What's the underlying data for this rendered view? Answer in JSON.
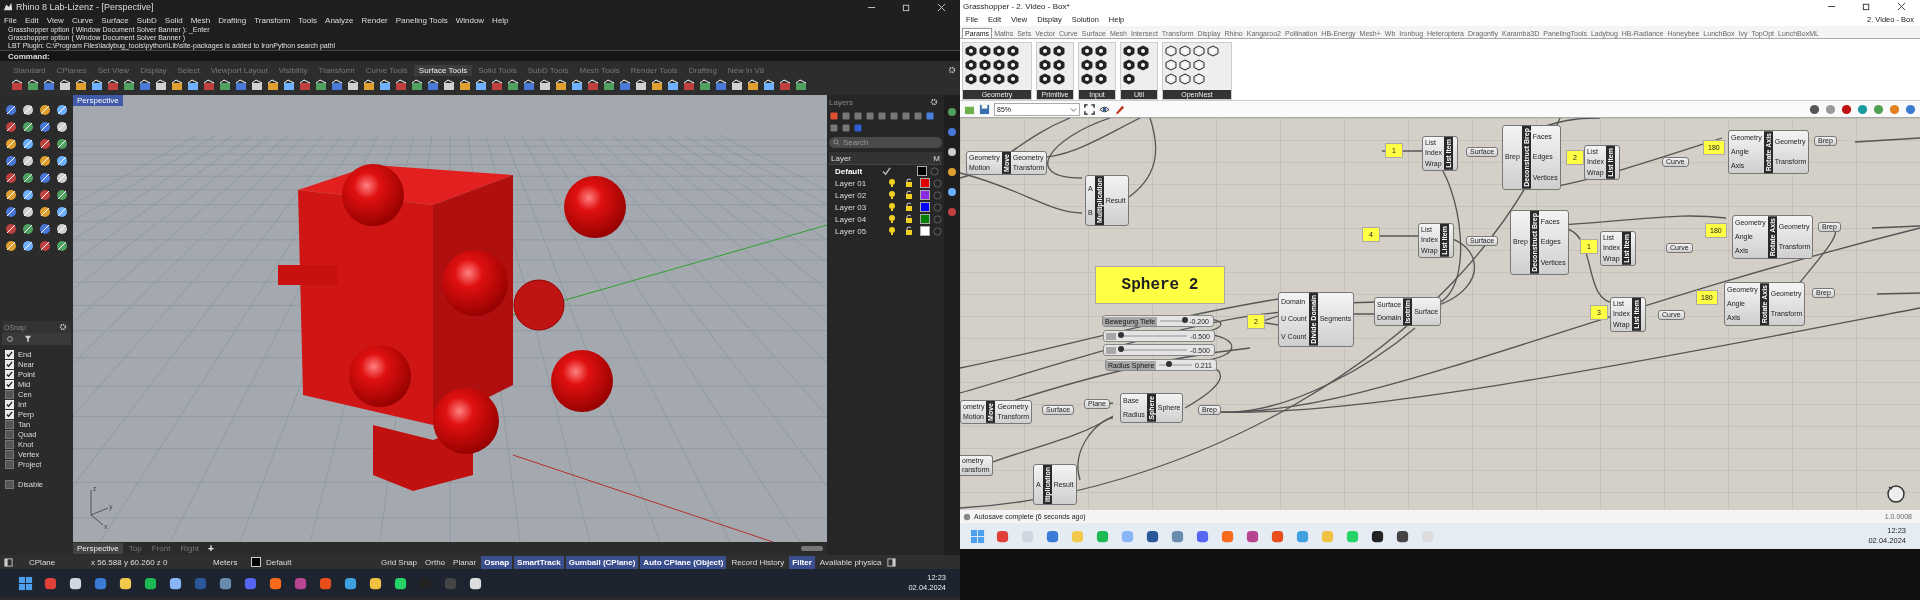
{
  "rhino": {
    "title": "Rhino 8 Lab-Lizenz - [Perspective]",
    "menu": [
      "File",
      "Edit",
      "View",
      "Curve",
      "Surface",
      "SubD",
      "Solid",
      "Mesh",
      "Drafting",
      "Transform",
      "Tools",
      "Analyze",
      "Render",
      "Paneling Tools",
      "Window",
      "Help"
    ],
    "command_history": [
      "Grasshopper option ( Window  Document  Solver  Banner ): _Enter",
      "Grasshopper option ( Window  Document  Solver  Banner )",
      "LBT Plugin: C:\\Program Files\\ladybug_tools\\python\\Lib\\site-packages is added to IronPython search path!"
    ],
    "command_label": "Command:",
    "toolbar_tabs": [
      {
        "label": "Standard",
        "selected": false
      },
      {
        "label": "CPlanes",
        "selected": false
      },
      {
        "label": "Set View",
        "selected": false
      },
      {
        "label": "Display",
        "selected": false
      },
      {
        "label": "Select",
        "selected": false
      },
      {
        "label": "Viewport Layout",
        "selected": false
      },
      {
        "label": "Visibility",
        "selected": false
      },
      {
        "label": "Transform",
        "selected": false
      },
      {
        "label": "Curve Tools",
        "selected": false
      },
      {
        "label": "Surface Tools",
        "selected": true
      },
      {
        "label": "Solid Tools",
        "selected": false
      },
      {
        "label": "SubD Tools",
        "selected": false
      },
      {
        "label": "Mesh Tools",
        "selected": false
      },
      {
        "label": "Render Tools",
        "selected": false
      },
      {
        "label": "Drafting",
        "selected": false
      },
      {
        "label": "New in V8",
        "selected": false
      }
    ],
    "viewport": {
      "label": "Perspective",
      "axis_labels": [
        "z",
        "y",
        "x"
      ]
    },
    "viewport_tabs": [
      {
        "label": "Perspective",
        "selected": true
      },
      {
        "label": "Top",
        "selected": false
      },
      {
        "label": "Front",
        "selected": false
      },
      {
        "label": "Right",
        "selected": false
      }
    ],
    "add_tab": "+",
    "osnap": {
      "title": "OSnap",
      "items": [
        {
          "label": "End",
          "checked": true
        },
        {
          "label": "Near",
          "checked": true
        },
        {
          "label": "Point",
          "checked": true
        },
        {
          "label": "Mid",
          "checked": true
        },
        {
          "label": "Cen",
          "checked": false
        },
        {
          "label": "Int",
          "checked": true
        },
        {
          "label": "Perp",
          "checked": true
        },
        {
          "label": "Tan",
          "checked": false
        },
        {
          "label": "Quad",
          "checked": false
        },
        {
          "label": "Knot",
          "checked": false
        },
        {
          "label": "Vertex",
          "checked": false
        },
        {
          "label": "Project",
          "checked": false
        }
      ],
      "disable": {
        "label": "Disable",
        "checked": false
      }
    },
    "layers": {
      "title": "Layers",
      "search_placeholder": "Search",
      "columns": [
        "Layer",
        "M"
      ],
      "rows": [
        {
          "name": "Default",
          "current": true,
          "color": "#000000"
        },
        {
          "name": "Layer 01",
          "current": false,
          "color": "#e00000"
        },
        {
          "name": "Layer 02",
          "current": false,
          "color": "#8a2be2"
        },
        {
          "name": "Layer 03",
          "current": false,
          "color": "#0000ff"
        },
        {
          "name": "Layer 04",
          "current": false,
          "color": "#008000"
        },
        {
          "name": "Layer 05",
          "current": false,
          "color": "#ffffff"
        }
      ]
    },
    "status": {
      "cplane": "CPlane",
      "coordinates": "x 56.588   y 60.260   z 0",
      "units": "Meters",
      "layer": "Default",
      "toggles": [
        {
          "label": "Grid Snap",
          "on": false
        },
        {
          "label": "Ortho",
          "on": false
        },
        {
          "label": "Planar",
          "on": false
        },
        {
          "label": "Osnap",
          "on": true
        },
        {
          "label": "SmartTrack",
          "on": true
        },
        {
          "label": "Gumball (CPlane)",
          "on": true
        },
        {
          "label": "Auto CPlane (Object)",
          "on": true
        },
        {
          "label": "Record History",
          "on": false
        },
        {
          "label": "Filter",
          "on": true
        },
        {
          "label": "Available physica",
          "on": false
        }
      ]
    }
  },
  "taskbar_left": {
    "time": "12:23",
    "date": "02.04.2024"
  },
  "grasshopper": {
    "title": "Grasshopper - 2. Video - Box*",
    "document": "2. Video - Box",
    "menu": [
      "File",
      "Edit",
      "View",
      "Display",
      "Solution",
      "Help"
    ],
    "tabs": [
      {
        "label": "Params",
        "selected": true
      },
      {
        "label": "Maths",
        "selected": false
      },
      {
        "label": "Sets",
        "selected": false
      },
      {
        "label": "Vector",
        "selected": false
      },
      {
        "label": "Curve",
        "selected": false
      },
      {
        "label": "Surface",
        "selected": false
      },
      {
        "label": "Mesh",
        "selected": false
      },
      {
        "label": "Intersect",
        "selected": false
      },
      {
        "label": "Transform",
        "selected": false
      },
      {
        "label": "Display",
        "selected": false
      },
      {
        "label": "Rhino",
        "selected": false
      },
      {
        "label": "Kangaroo2",
        "selected": false
      },
      {
        "label": "Pollination",
        "selected": false
      },
      {
        "label": "HB-Energy",
        "selected": false
      },
      {
        "label": "Mesh+",
        "selected": false
      },
      {
        "label": "Wb",
        "selected": false
      },
      {
        "label": "Ironbug",
        "selected": false
      },
      {
        "label": "Heteroptera",
        "selected": false
      },
      {
        "label": "Dragonfly",
        "selected": false
      },
      {
        "label": "Karamba3D",
        "selected": false
      },
      {
        "label": "PanelingTools",
        "selected": false
      },
      {
        "label": "Ladybug",
        "selected": false
      },
      {
        "label": "HB-Radiance",
        "selected": false
      },
      {
        "label": "Honeybee",
        "selected": false
      },
      {
        "label": "LunchBox",
        "selected": false
      },
      {
        "label": "Ivy",
        "selected": false
      },
      {
        "label": "TopOpt",
        "selected": false
      },
      {
        "label": "LunchBoxML",
        "selected": false
      }
    ],
    "ribbon_groups": [
      "Geometry",
      "Primitive",
      "Input",
      "Util",
      "OpenNest"
    ],
    "zoom": "85%",
    "nodes": [
      {
        "kind": "component",
        "title": "Move",
        "inputs": [
          "Geometry",
          "Motion"
        ],
        "outputs": [
          "Geometry",
          "Transform"
        ]
      },
      {
        "kind": "component",
        "title": "Multiplication",
        "inputs": [
          "A",
          "B"
        ],
        "outputs": [
          "Result"
        ]
      },
      {
        "kind": "big_panel",
        "text": "Sphere 2"
      },
      {
        "kind": "slider",
        "label": "Bewegung Tiefe",
        "value": "-0.200",
        "level": 0.95
      },
      {
        "kind": "slider",
        "value": "-0.500",
        "level": 0.03
      },
      {
        "kind": "slider",
        "value": "-0.500",
        "level": 0.03
      },
      {
        "kind": "slider",
        "label": "Radius Sphere",
        "value": "0.211",
        "level": 0.3
      },
      {
        "kind": "panel",
        "text": "2"
      },
      {
        "kind": "component",
        "title": "Divide Domain",
        "inputs": [
          "Domain",
          "U Count",
          "V Count"
        ],
        "outputs": [
          "Segments"
        ]
      },
      {
        "kind": "component",
        "title": "Isotrim",
        "inputs": [
          "Surface",
          "Domain"
        ],
        "outputs": [
          "Surface"
        ]
      },
      {
        "kind": "panel",
        "text": "1"
      },
      {
        "kind": "component",
        "title": "List Item",
        "inputs": [
          "List",
          "Index",
          "Wrap"
        ]
      },
      {
        "kind": "param",
        "label": "Surface"
      },
      {
        "kind": "panel",
        "text": "4"
      },
      {
        "kind": "component",
        "title": "List Item",
        "inputs": [
          "List",
          "Index",
          "Wrap"
        ]
      },
      {
        "kind": "param",
        "label": "Surface"
      },
      {
        "kind": "component",
        "title": "Move",
        "inputs": [
          "ometry",
          "Motion"
        ],
        "outputs": [
          "Geometry",
          "Transform"
        ]
      },
      {
        "kind": "param",
        "label": "Surface"
      },
      {
        "kind": "param",
        "label": "Plane"
      },
      {
        "kind": "component",
        "title": "Sphere",
        "inputs": [
          "Base",
          "Radius"
        ],
        "outputs": [
          "Sphere"
        ]
      },
      {
        "kind": "param",
        "label": "Brep"
      },
      {
        "kind": "fragment",
        "outputs": [
          "ometry",
          "ransform"
        ]
      },
      {
        "kind": "component",
        "title": "ltiplication",
        "inputs": [
          "A"
        ],
        "outputs": [
          "Result"
        ]
      },
      {
        "kind": "component",
        "title": "Deconstruct Brep",
        "inputs": [
          "Brep"
        ],
        "outputs": [
          "Faces",
          "Edges",
          "Vertices"
        ]
      },
      {
        "kind": "panel",
        "text": "2"
      },
      {
        "kind": "component",
        "title": "List Item",
        "inputs": [
          "List",
          "Index",
          "Wrap"
        ]
      },
      {
        "kind": "param",
        "label": "Curve"
      },
      {
        "kind": "panel",
        "text": "180"
      },
      {
        "kind": "component",
        "title": "Rotate Axis",
        "inputs": [
          "Geometry",
          "Angle",
          "Axis"
        ],
        "outputs": [
          "Geometry",
          "Transform"
        ]
      },
      {
        "kind": "param",
        "label": "Brep"
      },
      {
        "kind": "component",
        "title": "Deconstruct Brep",
        "inputs": [
          "Brep"
        ],
        "outputs": [
          "Faces",
          "Edges",
          "Vertices"
        ]
      },
      {
        "kind": "panel",
        "text": "1"
      },
      {
        "kind": "component",
        "title": "List Item",
        "inputs": [
          "List",
          "Index",
          "Wrap"
        ]
      },
      {
        "kind": "param",
        "label": "Curve"
      },
      {
        "kind": "panel",
        "text": "180"
      },
      {
        "kind": "component",
        "title": "Rotate Axis",
        "inputs": [
          "Geometry",
          "Angle",
          "Axis"
        ],
        "outputs": [
          "Geometry",
          "Transform"
        ]
      },
      {
        "kind": "param",
        "label": "Brep"
      },
      {
        "kind": "panel",
        "text": "3"
      },
      {
        "kind": "component",
        "title": "List Item",
        "inputs": [
          "List",
          "Index",
          "Wrap"
        ]
      },
      {
        "kind": "param",
        "label": "Curve"
      },
      {
        "kind": "panel",
        "text": "180"
      },
      {
        "kind": "component",
        "title": "Rotate Axis",
        "inputs": [
          "Geometry",
          "Angle",
          "Axis"
        ],
        "outputs": [
          "Geometry",
          "Transform"
        ]
      },
      {
        "kind": "param",
        "label": "Brep"
      }
    ],
    "status": "Autosave complete (6 seconds ago)",
    "version": "1.0.0008"
  },
  "taskbar_right": {
    "time": "12:23",
    "date": "02.04.2024"
  }
}
